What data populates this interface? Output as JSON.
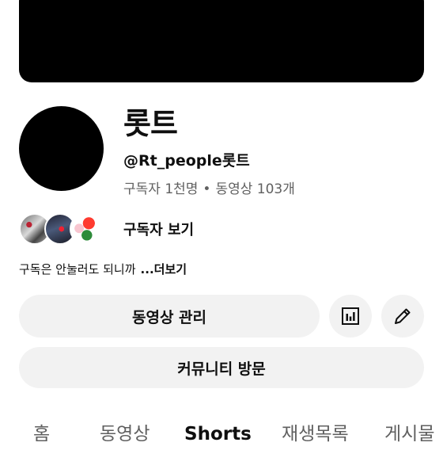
{
  "channel": {
    "name": "롯트",
    "handle": "@Rt_people롯트",
    "subscribers": "구독자 1천명",
    "separator": "•",
    "videos": "동영상 103개",
    "see_subscribers": "구독자 보기",
    "description": "구독은 안눌러도 되니까",
    "more": "...더보기"
  },
  "buttons": {
    "manage_videos": "동영상 관리",
    "analytics_icon": "bar-chart-icon",
    "edit_icon": "pencil-icon",
    "visit_community": "커뮤니티 방문"
  },
  "tabs": [
    {
      "label": "홈"
    },
    {
      "label": "동영상"
    },
    {
      "label": "Shorts",
      "active": true
    },
    {
      "label": "재생목록"
    },
    {
      "label": "게시물"
    }
  ],
  "colors": {
    "button_bg": "#f2f2f2",
    "secondary_text": "#606060",
    "primary_text": "#0f0f0f"
  }
}
